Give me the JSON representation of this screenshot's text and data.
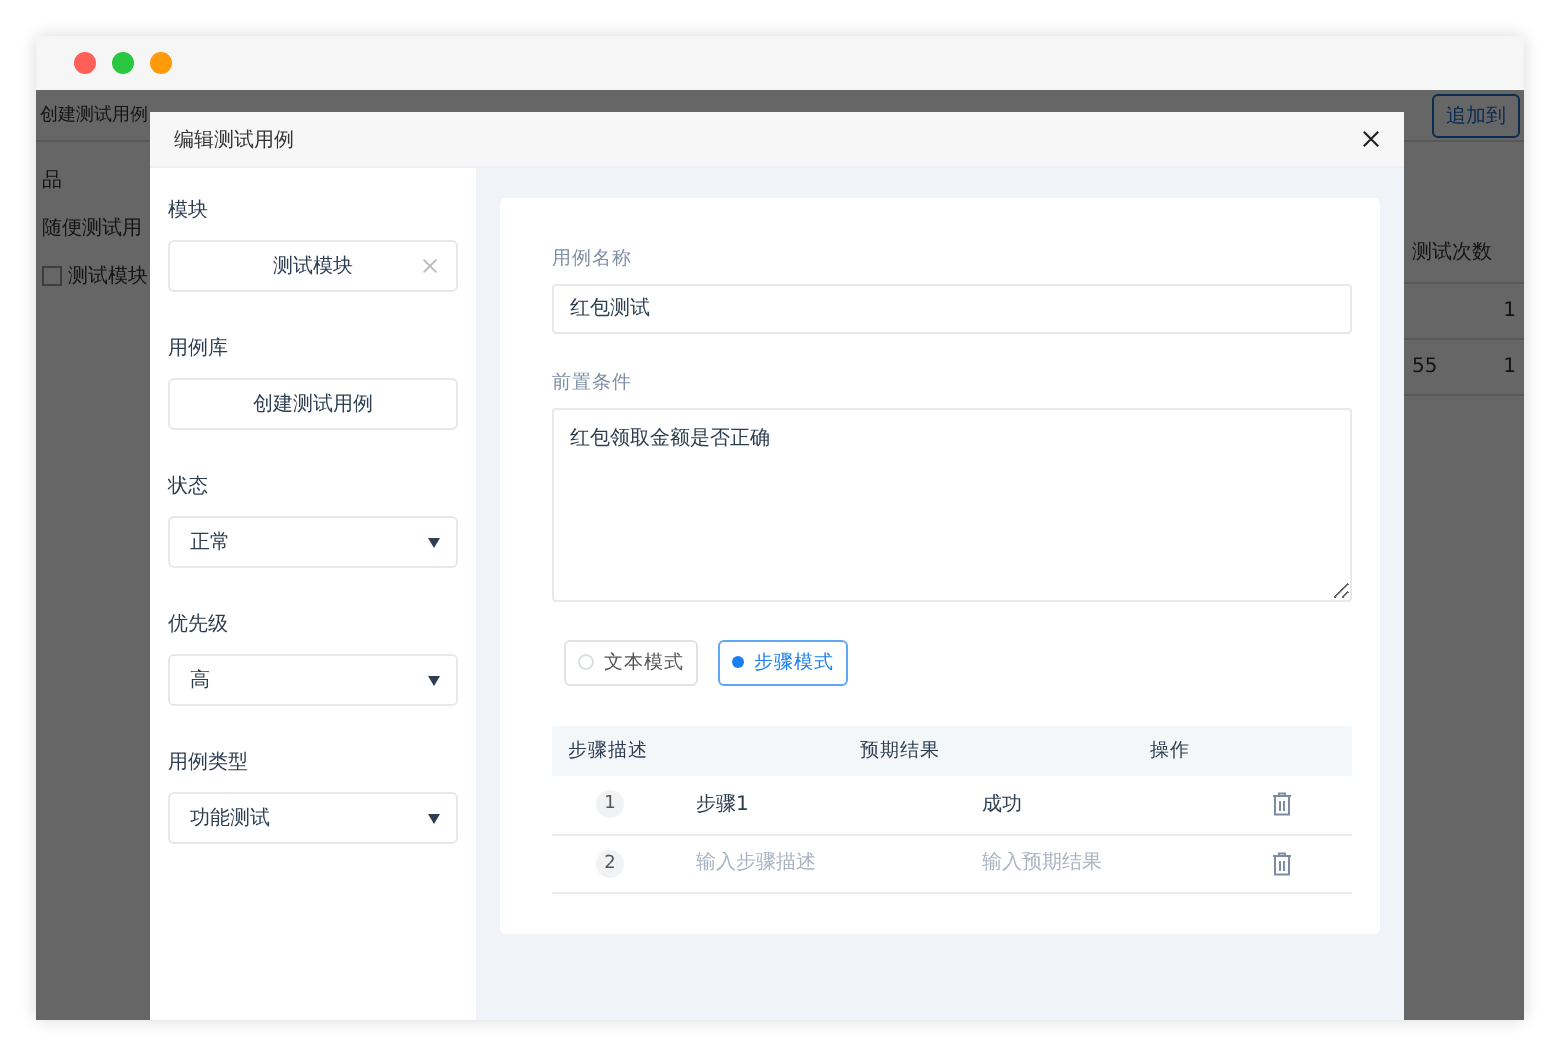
{
  "window": {
    "controls": [
      {
        "color": "#ff5f57"
      },
      {
        "color": "#28c840"
      },
      {
        "color": "#ff9a0a"
      }
    ]
  },
  "background": {
    "toolbar_title": "创建测试用例",
    "toolbar_button": "追加到",
    "sidebar": {
      "title": "品",
      "items": [
        {
          "label": "随便测试用",
          "kind": "text"
        },
        {
          "label": "测试模块",
          "kind": "checkbox",
          "checked": false
        }
      ]
    },
    "table": {
      "column": "测试次数",
      "rows": [
        {
          "count": "1"
        },
        {
          "column_1": "55",
          "count": "1"
        }
      ]
    }
  },
  "dialog": {
    "title": "编辑测试用例",
    "sidebar_fields": [
      {
        "label": "模块",
        "kind": "tag",
        "value": "测试模块"
      },
      {
        "label": "用例库",
        "kind": "button",
        "value": "创建测试用例"
      },
      {
        "label": "状态",
        "kind": "select",
        "value": "正常"
      },
      {
        "label": "优先级",
        "kind": "select",
        "value": "高"
      },
      {
        "label": "用例类型",
        "kind": "select",
        "value": "功能测试"
      }
    ],
    "form": {
      "name_label": "用例名称",
      "name_value": "红包测试",
      "precondition_label": "前置条件",
      "precondition_value": "红包领取金额是否正确",
      "modes": [
        {
          "label": "文本模式",
          "selected": false
        },
        {
          "label": "步骤模式",
          "selected": true
        }
      ],
      "steps": {
        "columns": [
          "步骤描述",
          "预期结果",
          "操作"
        ],
        "rows": [
          {
            "index": "1",
            "description": "步骤1",
            "expected": "成功"
          },
          {
            "index": "2",
            "description_placeholder": "输入步骤描述",
            "expected_placeholder": "输入预期结果"
          }
        ]
      }
    }
  }
}
